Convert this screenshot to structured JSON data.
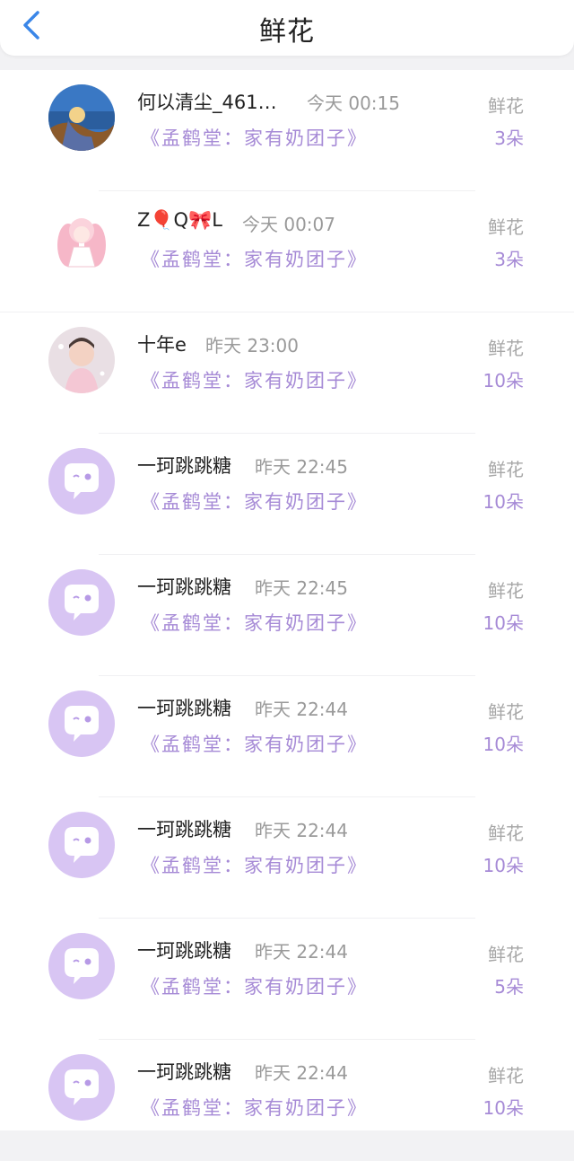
{
  "header": {
    "title": "鲜花",
    "back_icon": "chevron-left-icon",
    "accent": "#3a86e8"
  },
  "colors": {
    "book": "#a68ad6",
    "count": "#a68ad6",
    "default_avatar": "#d8c5f3"
  },
  "rows": [
    {
      "name": "何以清尘_461…",
      "time": "今天 00:15",
      "book": "《孟鹤堂：家有奶团子》",
      "gift": "鲜花",
      "count": "3朵",
      "avatar": "photo-beach"
    },
    {
      "name": "Z🎈Q🎀L",
      "time": "今天 00:07",
      "book": "《孟鹤堂：家有奶团子》",
      "gift": "鲜花",
      "count": "3朵",
      "avatar": "anime-girl"
    },
    {
      "name": "十年e",
      "time": "昨天 23:00",
      "book": "《孟鹤堂：家有奶团子》",
      "gift": "鲜花",
      "count": "10朵",
      "avatar": "photo-child"
    },
    {
      "name": "一珂跳跳糖",
      "time": "昨天 22:45",
      "book": "《孟鹤堂：家有奶团子》",
      "gift": "鲜花",
      "count": "10朵",
      "avatar": "default"
    },
    {
      "name": "一珂跳跳糖",
      "time": "昨天 22:45",
      "book": "《孟鹤堂：家有奶团子》",
      "gift": "鲜花",
      "count": "10朵",
      "avatar": "default"
    },
    {
      "name": "一珂跳跳糖",
      "time": "昨天 22:44",
      "book": "《孟鹤堂：家有奶团子》",
      "gift": "鲜花",
      "count": "10朵",
      "avatar": "default"
    },
    {
      "name": "一珂跳跳糖",
      "time": "昨天 22:44",
      "book": "《孟鹤堂：家有奶团子》",
      "gift": "鲜花",
      "count": "10朵",
      "avatar": "default"
    },
    {
      "name": "一珂跳跳糖",
      "time": "昨天 22:44",
      "book": "《孟鹤堂：家有奶团子》",
      "gift": "鲜花",
      "count": "5朵",
      "avatar": "default"
    },
    {
      "name": "一珂跳跳糖",
      "time": "昨天 22:44",
      "book": "《孟鹤堂：家有奶团子》",
      "gift": "鲜花",
      "count": "10朵",
      "avatar": "default"
    }
  ]
}
